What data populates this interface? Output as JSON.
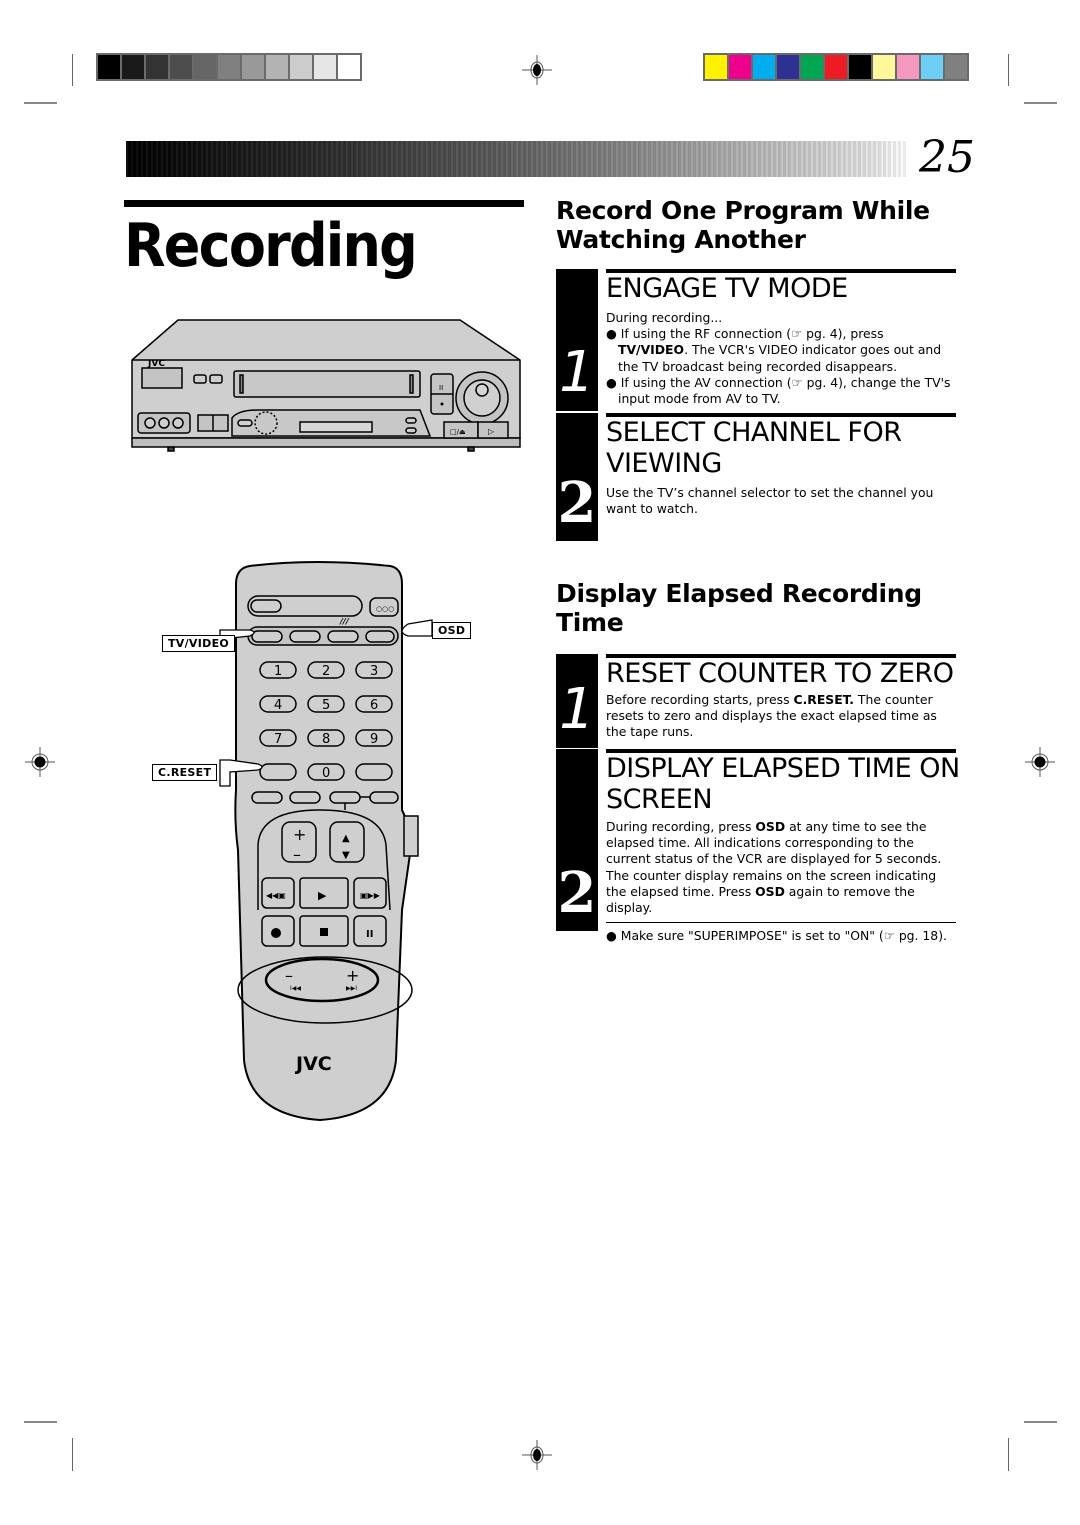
{
  "page": {
    "number": "25",
    "title": "Recording"
  },
  "print_marks": {
    "grayscale_swatches": [
      "#000000",
      "#1a1a1a",
      "#333333",
      "#4d4d4d",
      "#666666",
      "#808080",
      "#999999",
      "#b3b3b3",
      "#cccccc",
      "#e6e6e6",
      "#ffffff"
    ],
    "color_swatches": [
      "#fff200",
      "#ec008c",
      "#00aeef",
      "#2e3192",
      "#00a651",
      "#ed1c24",
      "#000000",
      "#fff799",
      "#f49ac1",
      "#6dcff6",
      "#808080"
    ]
  },
  "section1": {
    "heading_line1": "Record One Program While",
    "heading_line2": "Watching Another",
    "steps": [
      {
        "number": "1",
        "title": "ENGAGE TV MODE",
        "intro": "During recording...",
        "bullets": [
          {
            "pre": "If using the RF connection (",
            "icon": "☞",
            "mid": " pg. 4), press ",
            "bold": "TV/VIDEO",
            "post": ". The VCR's VIDEO indicator goes out and the TV broadcast being recorded disappears."
          },
          {
            "pre": "If using the AV connection (",
            "icon": "☞",
            "mid": " pg. 4), change the TV's input mode from AV to TV.",
            "bold": "",
            "post": ""
          }
        ]
      },
      {
        "number": "2",
        "title_line1": "SELECT CHANNEL FOR",
        "title_line2": "VIEWING",
        "text": "Use the TV’s channel selector to set the channel you want to watch."
      }
    ]
  },
  "section2": {
    "heading_line1": "Display Elapsed Recording",
    "heading_line2": "Time",
    "steps": [
      {
        "number": "1",
        "title": "RESET COUNTER TO ZERO",
        "pre": "Before recording starts, press ",
        "bold": "C.RESET.",
        "post": " The counter resets to zero and displays the exact elapsed time as the tape runs."
      },
      {
        "number": "2",
        "title_line1": "DISPLAY ELAPSED TIME ON",
        "title_line2": "SCREEN",
        "p1": "During recording, press ",
        "b1": "OSD",
        "p2": " at any time to see the elapsed time. All indications corresponding to the current status of the VCR are displayed for 5 seconds. The counter display remains on the screen indicating the elapsed time. Press ",
        "b2": "OSD",
        "p3": " again to remove the display.",
        "note_pre": "Make sure \"SUPERIMPOSE\" is set to \"ON\" (",
        "note_icon": "☞",
        "note_post": " pg. 18)."
      }
    ]
  },
  "vcr_illustration": {
    "brand": "JVC"
  },
  "remote_illustration": {
    "brand": "JVC",
    "callouts": {
      "tv_video": "TV/VIDEO",
      "osd": "OSD",
      "c_reset": "C.RESET"
    },
    "keypad": [
      "1",
      "2",
      "3",
      "4",
      "5",
      "6",
      "7",
      "8",
      "9",
      "",
      "0",
      ""
    ]
  }
}
